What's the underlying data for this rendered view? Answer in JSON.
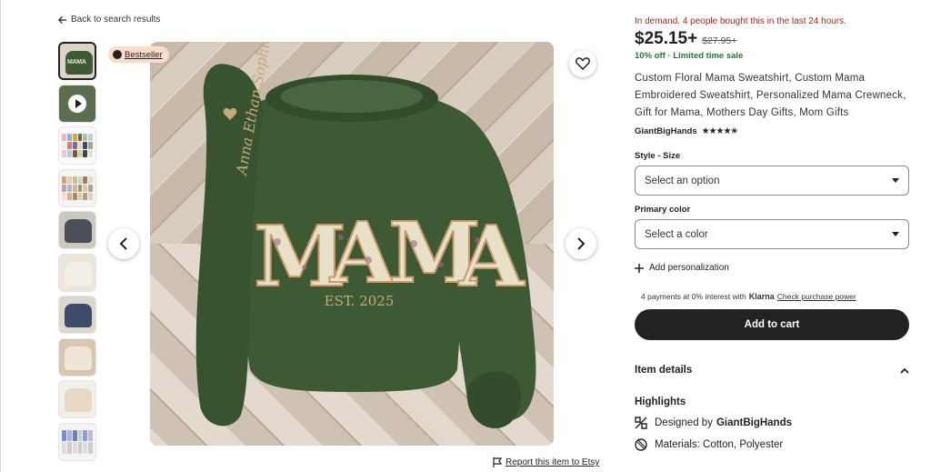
{
  "nav": {
    "back_label": "Back to search results"
  },
  "gallery": {
    "bestseller_label": "Bestseller",
    "thumb_active_text": "MAMA",
    "photo_title": "MAMA",
    "photo_est": "EST. 2025",
    "sleeve_names": "Anna Ethan Sophia",
    "report_label": "Report this item to Etsy"
  },
  "listing": {
    "demand_text": "In demand. 4 people bought this in the last 24 hours.",
    "price": "$25.15+",
    "original_price": "$27.95+",
    "discount": "10% off",
    "sale_text": "Limited time sale",
    "title": "Custom Floral Mama Sweatshirt, Custom Mama Embroidered Sweatshirt, Personalized Mama Crewneck, Gift for Mama, Mothers Day Gifts, Mom Gifts",
    "shop_name": "GiantBigHands",
    "rating_stars": "★★★★✬"
  },
  "options": {
    "style_label": "Style - Size",
    "style_value": "Select an option",
    "color_label": "Primary color",
    "color_value": "Select a color",
    "add_personalization": "Add personalization"
  },
  "klarna": {
    "text": "4 payments at 0% interest with",
    "brand": "Klarna",
    "link": "Check purchase power"
  },
  "cart": {
    "label": "Add to cart"
  },
  "details": {
    "heading": "Item details",
    "highlights": "Highlights",
    "designed_by_prefix": "Designed by",
    "designed_by_shop": "GiantBigHands",
    "materials": "Materials: Cotton, Polyester"
  },
  "colors": {
    "sweater": "#3e5a34",
    "accent_red": "#b3261e",
    "sale_green": "#1f7a3a",
    "badge_bg": "#fddbc8"
  }
}
